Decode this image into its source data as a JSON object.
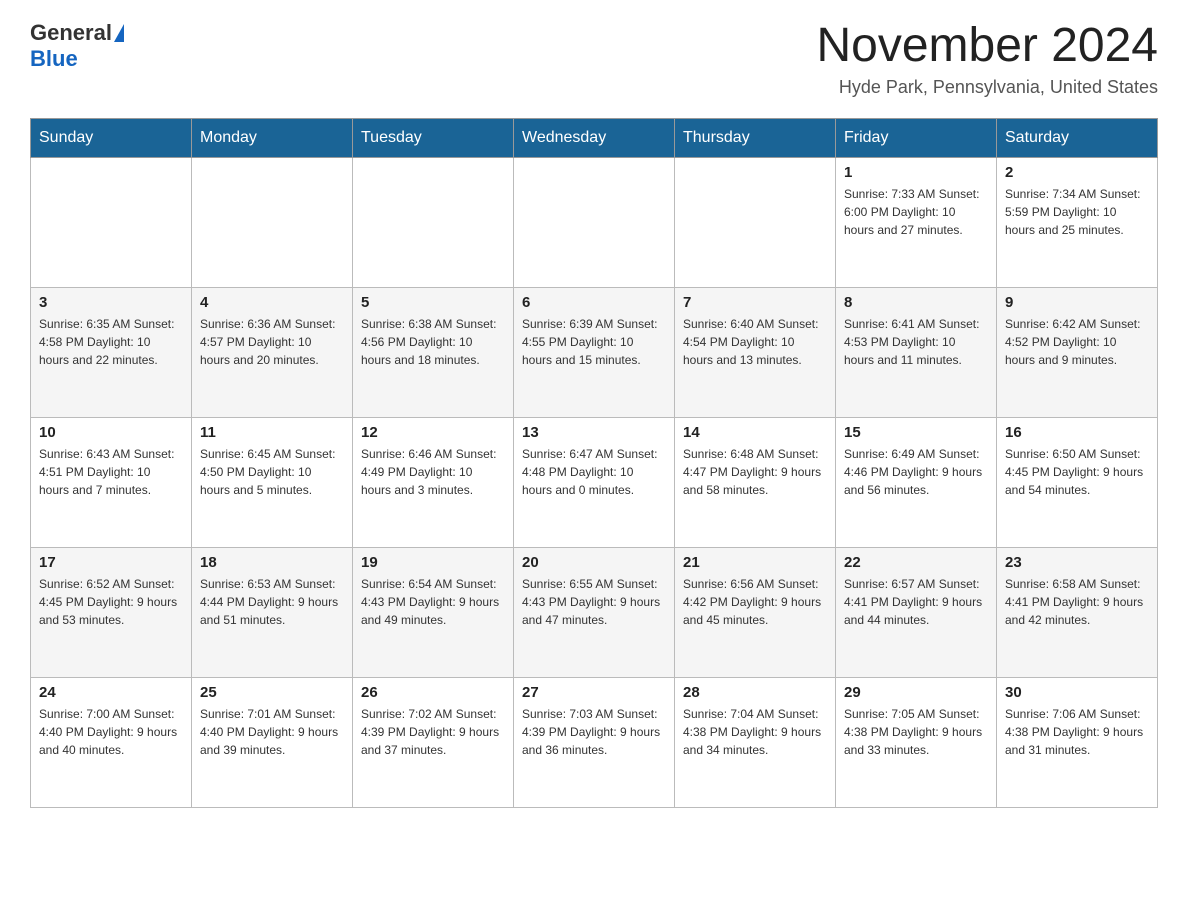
{
  "header": {
    "logo_general": "General",
    "logo_blue": "Blue",
    "month_title": "November 2024",
    "location": "Hyde Park, Pennsylvania, United States"
  },
  "calendar": {
    "days_of_week": [
      "Sunday",
      "Monday",
      "Tuesday",
      "Wednesday",
      "Thursday",
      "Friday",
      "Saturday"
    ],
    "weeks": [
      [
        {
          "day": "",
          "info": ""
        },
        {
          "day": "",
          "info": ""
        },
        {
          "day": "",
          "info": ""
        },
        {
          "day": "",
          "info": ""
        },
        {
          "day": "",
          "info": ""
        },
        {
          "day": "1",
          "info": "Sunrise: 7:33 AM\nSunset: 6:00 PM\nDaylight: 10 hours and 27 minutes."
        },
        {
          "day": "2",
          "info": "Sunrise: 7:34 AM\nSunset: 5:59 PM\nDaylight: 10 hours and 25 minutes."
        }
      ],
      [
        {
          "day": "3",
          "info": "Sunrise: 6:35 AM\nSunset: 4:58 PM\nDaylight: 10 hours and 22 minutes."
        },
        {
          "day": "4",
          "info": "Sunrise: 6:36 AM\nSunset: 4:57 PM\nDaylight: 10 hours and 20 minutes."
        },
        {
          "day": "5",
          "info": "Sunrise: 6:38 AM\nSunset: 4:56 PM\nDaylight: 10 hours and 18 minutes."
        },
        {
          "day": "6",
          "info": "Sunrise: 6:39 AM\nSunset: 4:55 PM\nDaylight: 10 hours and 15 minutes."
        },
        {
          "day": "7",
          "info": "Sunrise: 6:40 AM\nSunset: 4:54 PM\nDaylight: 10 hours and 13 minutes."
        },
        {
          "day": "8",
          "info": "Sunrise: 6:41 AM\nSunset: 4:53 PM\nDaylight: 10 hours and 11 minutes."
        },
        {
          "day": "9",
          "info": "Sunrise: 6:42 AM\nSunset: 4:52 PM\nDaylight: 10 hours and 9 minutes."
        }
      ],
      [
        {
          "day": "10",
          "info": "Sunrise: 6:43 AM\nSunset: 4:51 PM\nDaylight: 10 hours and 7 minutes."
        },
        {
          "day": "11",
          "info": "Sunrise: 6:45 AM\nSunset: 4:50 PM\nDaylight: 10 hours and 5 minutes."
        },
        {
          "day": "12",
          "info": "Sunrise: 6:46 AM\nSunset: 4:49 PM\nDaylight: 10 hours and 3 minutes."
        },
        {
          "day": "13",
          "info": "Sunrise: 6:47 AM\nSunset: 4:48 PM\nDaylight: 10 hours and 0 minutes."
        },
        {
          "day": "14",
          "info": "Sunrise: 6:48 AM\nSunset: 4:47 PM\nDaylight: 9 hours and 58 minutes."
        },
        {
          "day": "15",
          "info": "Sunrise: 6:49 AM\nSunset: 4:46 PM\nDaylight: 9 hours and 56 minutes."
        },
        {
          "day": "16",
          "info": "Sunrise: 6:50 AM\nSunset: 4:45 PM\nDaylight: 9 hours and 54 minutes."
        }
      ],
      [
        {
          "day": "17",
          "info": "Sunrise: 6:52 AM\nSunset: 4:45 PM\nDaylight: 9 hours and 53 minutes."
        },
        {
          "day": "18",
          "info": "Sunrise: 6:53 AM\nSunset: 4:44 PM\nDaylight: 9 hours and 51 minutes."
        },
        {
          "day": "19",
          "info": "Sunrise: 6:54 AM\nSunset: 4:43 PM\nDaylight: 9 hours and 49 minutes."
        },
        {
          "day": "20",
          "info": "Sunrise: 6:55 AM\nSunset: 4:43 PM\nDaylight: 9 hours and 47 minutes."
        },
        {
          "day": "21",
          "info": "Sunrise: 6:56 AM\nSunset: 4:42 PM\nDaylight: 9 hours and 45 minutes."
        },
        {
          "day": "22",
          "info": "Sunrise: 6:57 AM\nSunset: 4:41 PM\nDaylight: 9 hours and 44 minutes."
        },
        {
          "day": "23",
          "info": "Sunrise: 6:58 AM\nSunset: 4:41 PM\nDaylight: 9 hours and 42 minutes."
        }
      ],
      [
        {
          "day": "24",
          "info": "Sunrise: 7:00 AM\nSunset: 4:40 PM\nDaylight: 9 hours and 40 minutes."
        },
        {
          "day": "25",
          "info": "Sunrise: 7:01 AM\nSunset: 4:40 PM\nDaylight: 9 hours and 39 minutes."
        },
        {
          "day": "26",
          "info": "Sunrise: 7:02 AM\nSunset: 4:39 PM\nDaylight: 9 hours and 37 minutes."
        },
        {
          "day": "27",
          "info": "Sunrise: 7:03 AM\nSunset: 4:39 PM\nDaylight: 9 hours and 36 minutes."
        },
        {
          "day": "28",
          "info": "Sunrise: 7:04 AM\nSunset: 4:38 PM\nDaylight: 9 hours and 34 minutes."
        },
        {
          "day": "29",
          "info": "Sunrise: 7:05 AM\nSunset: 4:38 PM\nDaylight: 9 hours and 33 minutes."
        },
        {
          "day": "30",
          "info": "Sunrise: 7:06 AM\nSunset: 4:38 PM\nDaylight: 9 hours and 31 minutes."
        }
      ]
    ]
  }
}
